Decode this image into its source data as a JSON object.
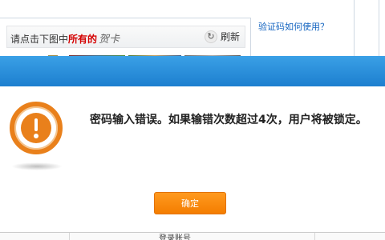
{
  "captcha": {
    "prompt_prefix": "请点击下图中",
    "prompt_highlight": "所有的",
    "prompt_target": "贺卡",
    "refresh_label": "刷新",
    "help_link": "验证码如何使用？"
  },
  "dialog": {
    "message": "密码输入错误。如果输错次数超过4次，用户将被锁定。",
    "ok_label": "确定"
  },
  "bottom": {
    "partial_text": "登录账号"
  },
  "colors": {
    "header_blue": "#1d7fcf",
    "accent_orange": "#f47d00",
    "highlight_red": "#d40000",
    "link_blue": "#1565c0"
  },
  "icons": {
    "alert": "exclamation-circle-icon",
    "refresh": "refresh-icon"
  }
}
